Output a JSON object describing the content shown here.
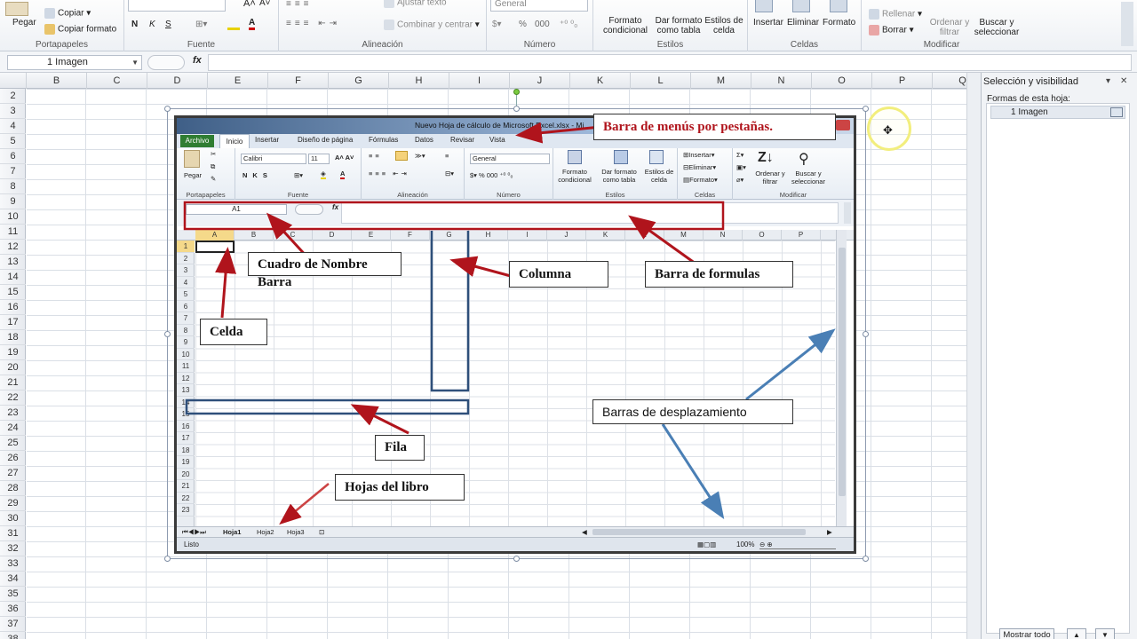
{
  "ribbon": {
    "portapapeles": {
      "label": "Portapapeles",
      "pegar": "Pegar",
      "copiar": "Copiar",
      "copiar_formato": "Copiar formato"
    },
    "fuente": {
      "label": "Fuente",
      "bold": "N",
      "italic": "K",
      "underline": "S"
    },
    "alineacion": {
      "label": "Alineación",
      "ajustar": "Ajustar texto",
      "combinar": "Combinar y centrar"
    },
    "numero": {
      "label": "Número",
      "format": "General",
      "pct": "%",
      "thousands": "000"
    },
    "estilos": {
      "label": "Estilos",
      "formato_condicional": "Formato condicional",
      "dar_formato": "Dar formato como tabla",
      "estilos_celda": "Estilos de celda"
    },
    "celdas": {
      "label": "Celdas",
      "insertar": "Insertar",
      "eliminar": "Eliminar",
      "formato": "Formato"
    },
    "modificar": {
      "label": "Modificar",
      "rellenar": "Rellenar",
      "borrar": "Borrar",
      "ordenar": "Ordenar y filtrar",
      "buscar": "Buscar y seleccionar"
    }
  },
  "formula_bar": {
    "name_box": "1 Imagen",
    "fx": "fx"
  },
  "columns": [
    "B",
    "C",
    "D",
    "E",
    "F",
    "G",
    "H",
    "I",
    "J",
    "K",
    "L",
    "M",
    "N",
    "O",
    "P",
    "Q"
  ],
  "rows": [
    "2",
    "3",
    "4",
    "5",
    "6",
    "7",
    "8",
    "9",
    "10",
    "11",
    "12",
    "13",
    "14",
    "15",
    "16",
    "17",
    "18",
    "19",
    "20",
    "21",
    "22",
    "23",
    "24",
    "25",
    "26",
    "27",
    "28",
    "29",
    "30",
    "31",
    "32",
    "33",
    "34",
    "35",
    "36",
    "37",
    "38"
  ],
  "pane": {
    "title": "Selección y visibilidad",
    "subtitle": "Formas de esta hoja:",
    "item": "1 Imagen",
    "show_all": "Mostrar todo"
  },
  "image": {
    "title": "Nuevo Hoja de cálculo de Microsoft Excel.xlsx - Mi",
    "tabs": [
      "Archivo",
      "Inicio",
      "Insertar",
      "Diseño de página",
      "Fórmulas",
      "Datos",
      "Revisar",
      "Vista"
    ],
    "groups": [
      "Portapapeles",
      "Fuente",
      "Alineación",
      "Número",
      "Estilos",
      "Celdas",
      "Modificar"
    ],
    "pegar": "Pegar",
    "font": "Calibri",
    "size": "11",
    "number_format": "General",
    "formato_condicional": "Formato condicional",
    "dar_formato": "Dar formato como tabla",
    "estilos_celda": "Estilos de celda",
    "insertar": "Insertar",
    "eliminar": "Eliminar",
    "formato": "Formato",
    "ordenar": "Ordenar y filtrar",
    "buscar": "Buscar y seleccionar",
    "name_box": "A1",
    "fx": "fx",
    "columns": [
      "A",
      "B",
      "C",
      "D",
      "E",
      "F",
      "G",
      "H",
      "I",
      "J",
      "K",
      "L",
      "M",
      "N",
      "O",
      "P"
    ],
    "rows": [
      "1",
      "2",
      "3",
      "4",
      "5",
      "6",
      "7",
      "8",
      "9",
      "10",
      "11",
      "12",
      "13",
      "14",
      "15",
      "16",
      "17",
      "18",
      "19",
      "20",
      "21",
      "22",
      "23"
    ],
    "sheets": [
      "Hoja1",
      "Hoja2",
      "Hoja3"
    ],
    "status": "Listo",
    "zoom": "100%"
  },
  "annotations": {
    "menu_tabs": "Barra de menús por pestañas.",
    "cuadro_nombre": "Cuadro de Nombre",
    "barra": "Barra",
    "columna": "Columna",
    "barra_formulas": "Barra de formulas",
    "celda": "Celda",
    "barras_desplazamiento": "Barras de desplazamiento",
    "fila": "Fila",
    "hojas_libro": "Hojas del libro"
  },
  "colors": {
    "red_annotation": "#b0141c",
    "blue_annotation": "#4a7fb5",
    "column_highlight": "#2e4f7a"
  }
}
